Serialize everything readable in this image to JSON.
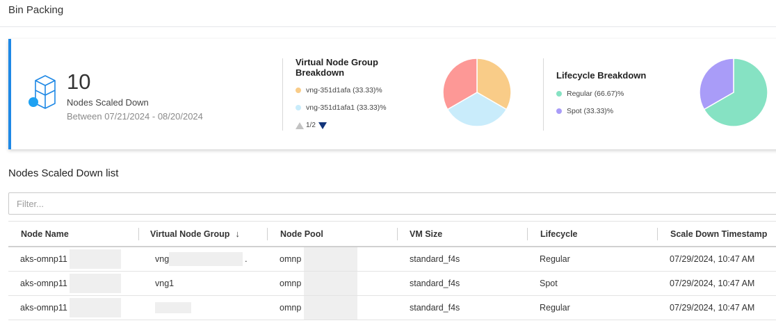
{
  "page": {
    "title": "Bin Packing"
  },
  "summary": {
    "count": "10",
    "label": "Nodes Scaled Down",
    "date_range": "Between 07/21/2024 - 08/20/2024"
  },
  "vng_breakdown": {
    "title": "Virtual Node Group Breakdown",
    "legend": [
      {
        "label": "vng-351d1afa (33.33)%",
        "color": "#f9cc88"
      },
      {
        "label": "vng-351d1afa1 (33.33)%",
        "color": "#c9ecfb"
      }
    ],
    "pager": "1/2",
    "slices": [
      {
        "value": 33.33,
        "color": "#f9cc88"
      },
      {
        "value": 33.33,
        "color": "#c9ecfb"
      },
      {
        "value": 33.34,
        "color": "#fd9896"
      }
    ]
  },
  "lifecycle_breakdown": {
    "title": "Lifecycle Breakdown",
    "legend": [
      {
        "label": "Regular (66.67)%",
        "color": "#86e2c3"
      },
      {
        "label": "Spot (33.33)%",
        "color": "#a99cf8"
      }
    ],
    "slices": [
      {
        "value": 66.67,
        "color": "#86e2c3"
      },
      {
        "value": 33.33,
        "color": "#a99cf8"
      }
    ]
  },
  "list": {
    "title": "Nodes Scaled Down list",
    "filter_placeholder": "Filter...",
    "columns": [
      "Node Name",
      "Virtual Node Group",
      "Node Pool",
      "VM Size",
      "Lifecycle",
      "Scale Down Timestamp"
    ],
    "sort_indicator": "↓",
    "rows": [
      {
        "node_name": "aks-omnp11",
        "vng": "vng",
        "vng_tail": ".",
        "node_pool": "omnp",
        "vm_size": "standard_f4s",
        "lifecycle": "Regular",
        "timestamp": "07/29/2024, 10:47 AM"
      },
      {
        "node_name": "aks-omnp11",
        "vng": "vng1",
        "vng_tail": "",
        "node_pool": "omnp",
        "vm_size": "standard_f4s",
        "lifecycle": "Spot",
        "timestamp": "07/29/2024, 10:47 AM"
      },
      {
        "node_name": "aks-omnp11",
        "vng": "",
        "vng_tail": "",
        "node_pool": "omnp",
        "vm_size": "standard_f4s",
        "lifecycle": "Regular",
        "timestamp": "07/29/2024, 10:47 AM"
      }
    ]
  },
  "colors": {
    "accent": "#1e88e5",
    "pager_active": "#12357a"
  },
  "icons": {
    "summary": "cube-stack-icon",
    "sort": "sort-down-arrow-icon",
    "pager_prev": "triangle-up-icon",
    "pager_next": "triangle-down-icon"
  }
}
